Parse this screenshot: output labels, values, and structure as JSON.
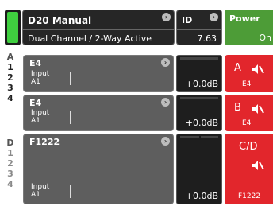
{
  "header": {
    "preset_title": "D20 Manual",
    "preset_mode": "Dual Channel / 2-Way Active",
    "id_label": "ID",
    "id_value": "7.63",
    "power_label": "Power",
    "power_value": "On"
  },
  "row_labels": {
    "group1": [
      "A",
      "1",
      "2",
      "3",
      "4"
    ],
    "group2": [
      "D",
      "1",
      "2",
      "3",
      "4"
    ]
  },
  "channels": [
    {
      "name": "E4",
      "input_label": "Input",
      "input_value": "A1",
      "gain": "+0.0dB",
      "output": "A",
      "output_sub": "E4"
    },
    {
      "name": "E4",
      "input_label": "Input",
      "input_value": "A1",
      "gain": "+0.0dB",
      "output": "B",
      "output_sub": "E4"
    },
    {
      "name": "F1222",
      "input_label": "Input",
      "input_value": "A1",
      "gain": "+0.0dB",
      "output": "C/D",
      "output_sub": "F1222"
    }
  ],
  "colors": {
    "power_green": "#4d9c37",
    "mute_red": "#e2262c",
    "led_green": "#3fcf3f"
  },
  "icons": {
    "chevron": "chevron-right-icon",
    "mute": "speaker-mute-icon"
  }
}
